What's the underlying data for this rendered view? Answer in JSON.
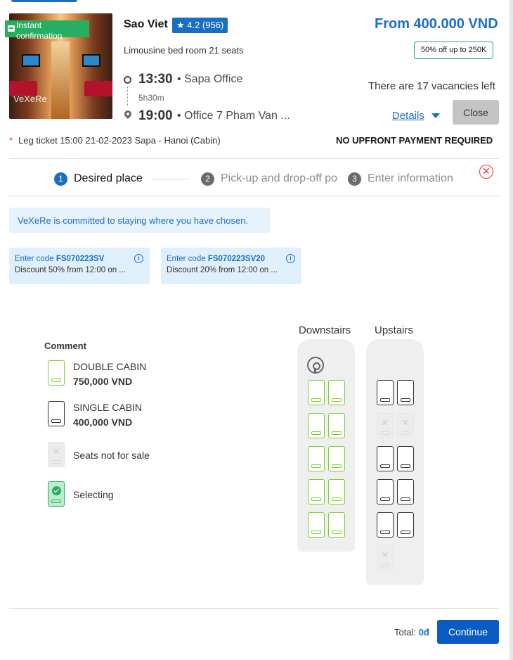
{
  "trip": {
    "operator": "Sao Viet",
    "rating": "4.2 (956)",
    "price": "From 400.000 VND",
    "bus_type": "Limousine bed room 21 seats",
    "promo": "50% off up to 250K",
    "instant_line1": "Instant",
    "instant_line2": "confirmation",
    "watermark": "VeXeRe",
    "depart_time": "13:30",
    "depart_place": "Sapa Office",
    "duration": "5h30m",
    "arrive_time": "19:00",
    "arrive_place": "Office 7 Pham Van ...",
    "vacancies": "There are 17 vacancies left",
    "details_label": "Details",
    "close_label": "Close",
    "leg_ticket": "Leg ticket 15:00 21-02-2023 Sapa - Hanoi (Cabin)",
    "no_upfront": "NO UPFRONT PAYMENT REQUIRED"
  },
  "steps": [
    {
      "num": "1",
      "label": "Desired place",
      "active": true
    },
    {
      "num": "2",
      "label": "Pick-up and drop-off po",
      "active": false
    },
    {
      "num": "3",
      "label": "Enter information",
      "active": false
    }
  ],
  "notice": "VeXeRe is committed to staying where you have chosen.",
  "coupons": [
    {
      "prefix": "Enter code ",
      "code": "FS070223SV",
      "desc": "Discount 50% from 12:00 on ..."
    },
    {
      "prefix": "Enter code ",
      "code": "FS070223SV20",
      "desc": "Discount 20% from 12:00 on ..."
    }
  ],
  "legend": {
    "title": "Comment",
    "items": [
      {
        "label": "DOUBLE CABIN",
        "price": "750,000 VND",
        "kind": "double"
      },
      {
        "label": "SINGLE CABIN",
        "price": "400,000 VND",
        "kind": "single"
      },
      {
        "label": "Seats not for sale",
        "kind": "unavailable"
      },
      {
        "label": "Selecting",
        "kind": "selecting"
      }
    ]
  },
  "decks": {
    "downstairs_label": "Downstairs",
    "upstairs_label": "Upstairs",
    "downstairs_rows": [
      [
        "double",
        "double"
      ],
      [
        "double",
        "double"
      ],
      [
        "double",
        "double"
      ],
      [
        "double",
        "double"
      ],
      [
        "double",
        "double"
      ]
    ],
    "upstairs_rows": [
      [
        "single",
        "single"
      ],
      [
        "unavailable",
        "unavailable"
      ],
      [
        "single",
        "single"
      ],
      [
        "single",
        "single"
      ],
      [
        "single",
        "single"
      ],
      [
        "unavailable"
      ]
    ]
  },
  "footer": {
    "total_label": "Total:",
    "total_value": "0đ",
    "continue_label": "Continue"
  },
  "colors": {
    "brand_blue": "#1a6fc4",
    "double_cabin": "#7ad12a",
    "selected": "#27ae60",
    "alert_red": "#e33"
  }
}
